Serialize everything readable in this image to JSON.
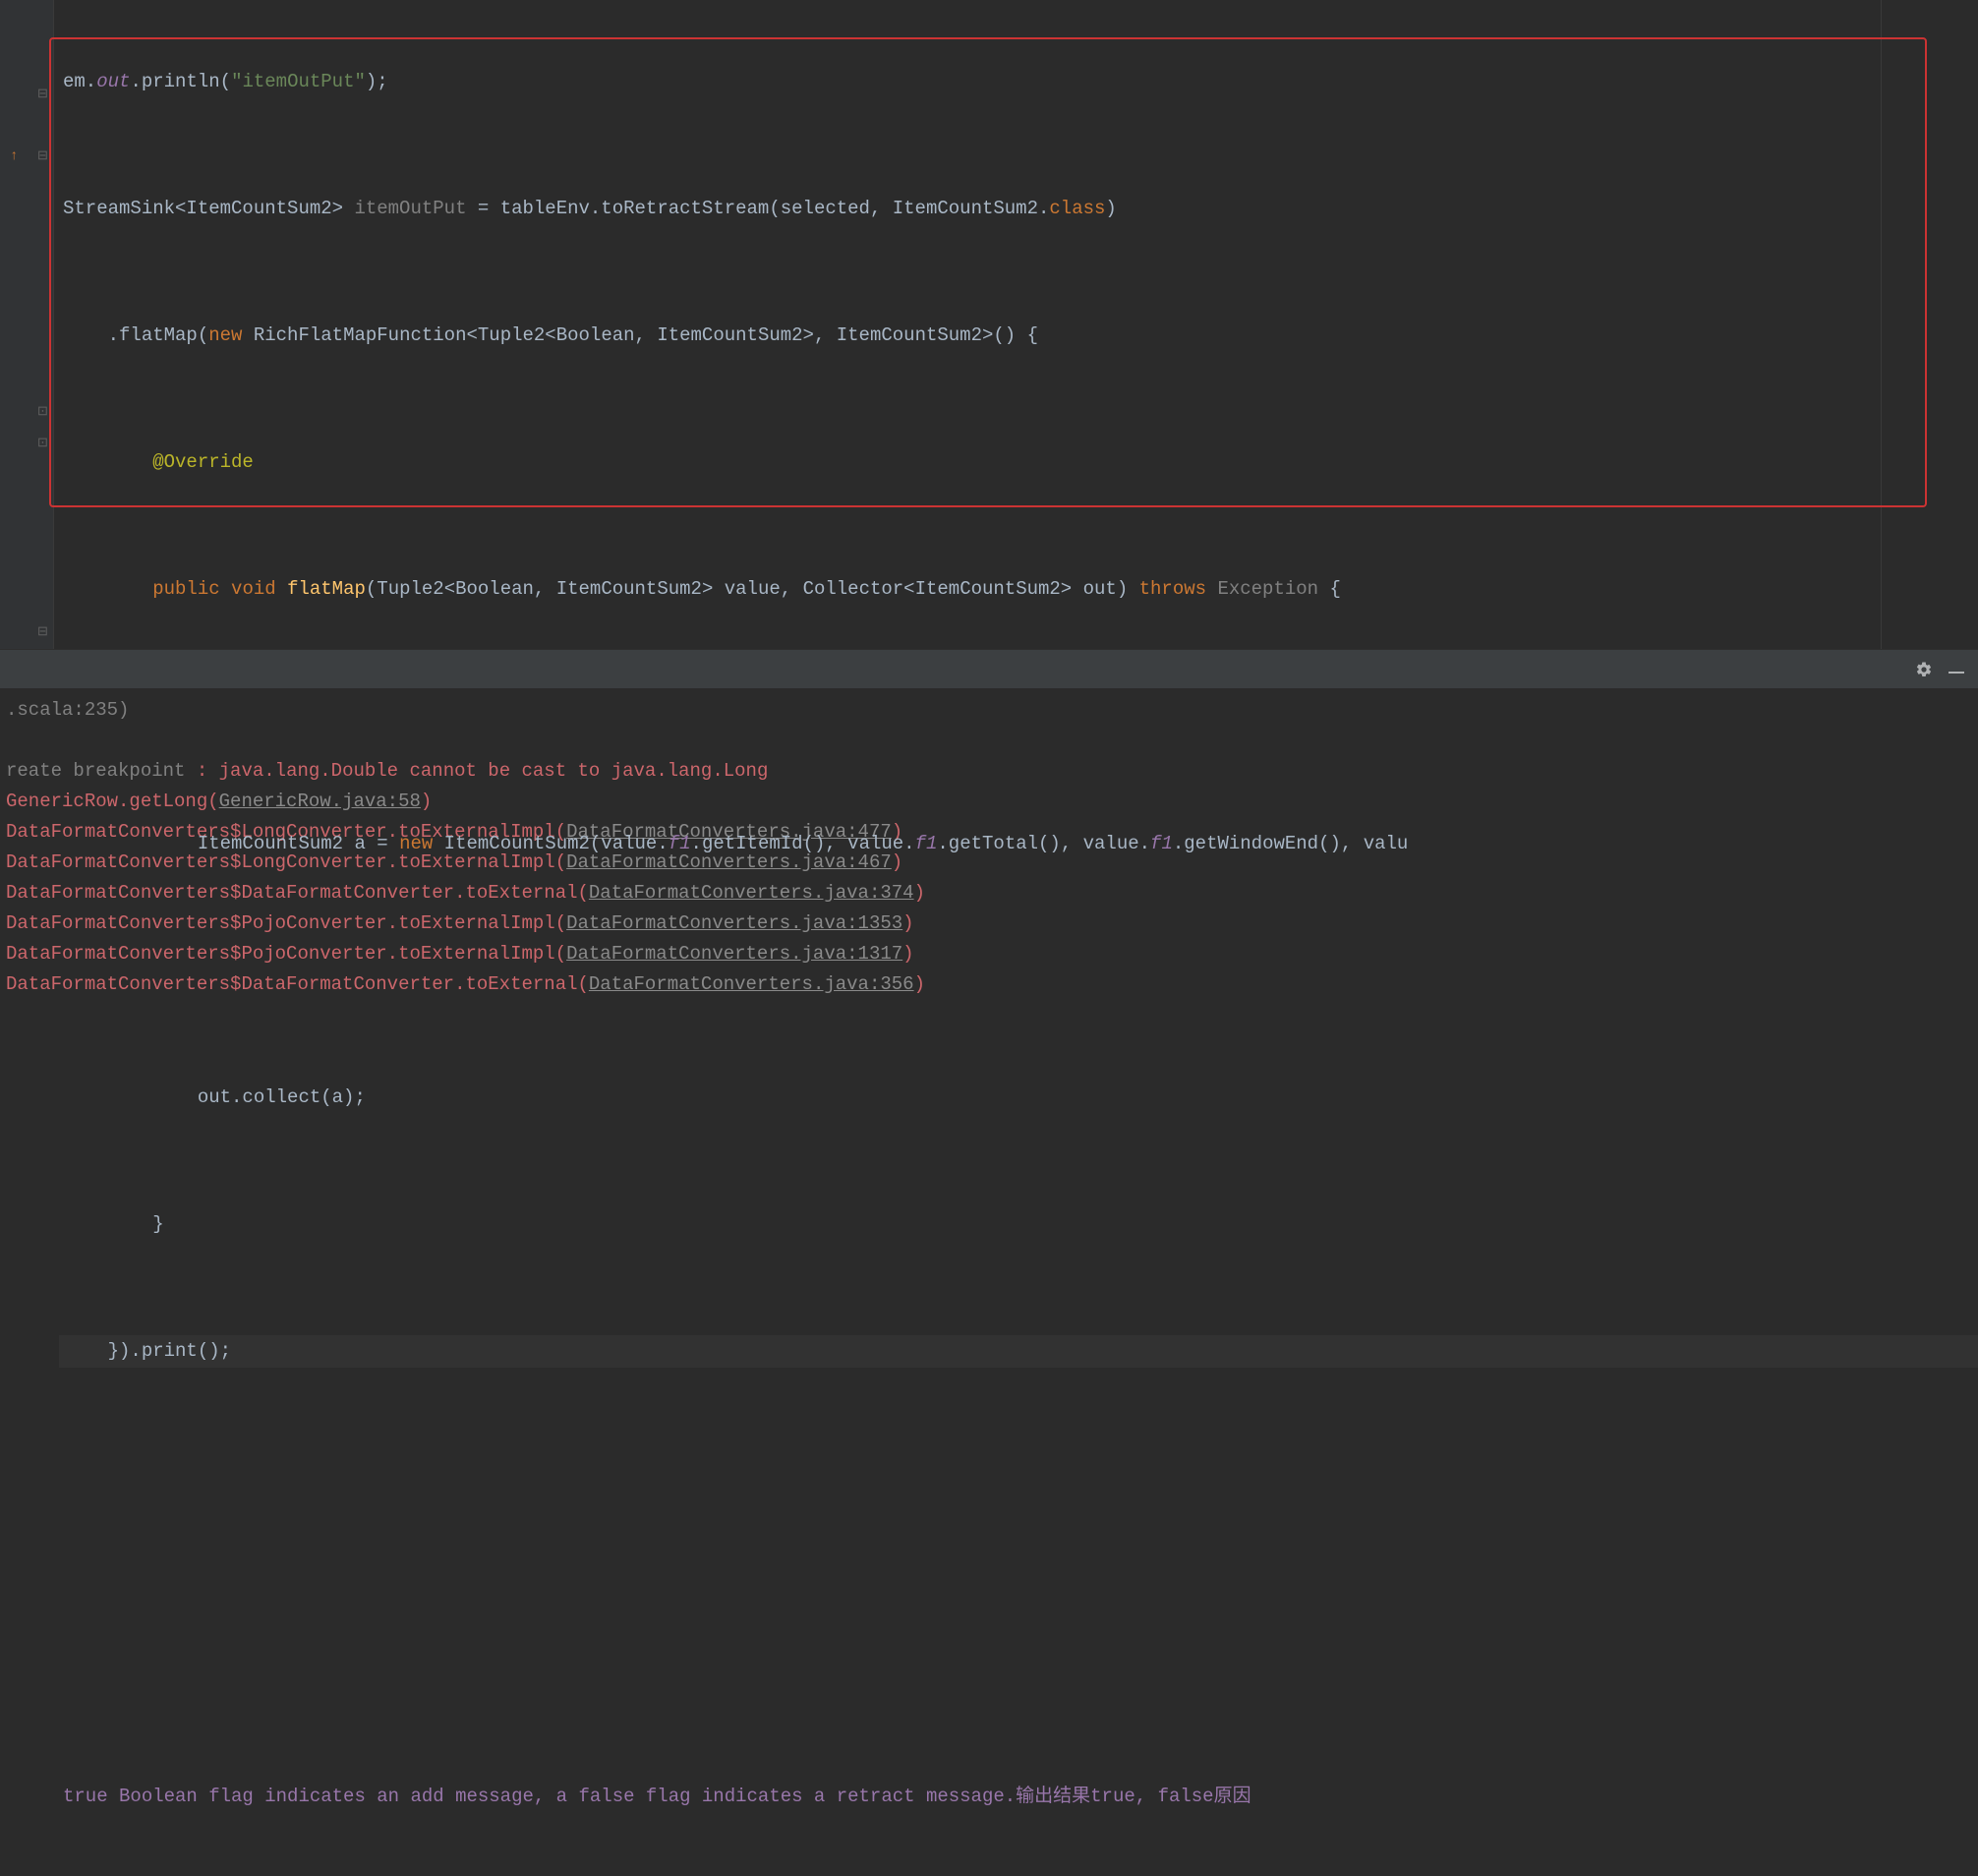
{
  "editor": {
    "lines": {
      "l1_pre": "em.",
      "l1_out": "out",
      "l1_post": ".println(",
      "l1_str": "\"itemOutPut\"",
      "l1_end": ");",
      "l2_pre": "StreamSink<ItemCountSum2> ",
      "l2_var": "itemOutPut",
      "l2_mid": " = tableEnv.toRetractStream(selected, ItemCountSum2.",
      "l2_class": "class",
      "l2_end": ")",
      "l3_pre": "    .flatMap(",
      "l3_new": "new",
      "l3_post": " RichFlatMapFunction<Tuple2<Boolean, ItemCountSum2>, ItemCountSum2>() {",
      "l4_pre": "        ",
      "l4_anno": "@Override",
      "l5_pre": "        ",
      "l5_public": "public",
      "l5_sp1": " ",
      "l5_void": "void",
      "l5_sp2": " ",
      "l5_method": "flatMap",
      "l5_post": "(Tuple2<Boolean, ItemCountSum2> value, Collector<ItemCountSum2> out) ",
      "l5_throws": "throws",
      "l5_sp3": " ",
      "l5_exc": "Exception",
      "l5_end": " {",
      "l6_pre": "            ItemCountSum2 a = ",
      "l6_new": "new",
      "l6_post": " ItemCountSum2(value.",
      "l6_f1a": "f1",
      "l6_m1": ".getItemId(), value.",
      "l6_f1b": "f1",
      "l6_m2": ".getTotal(), value.",
      "l6_f1c": "f1",
      "l6_m3": ".getWindowEnd(), valu",
      "l7": "            out.collect(a);",
      "l8": "        }",
      "l9": "    }).print();",
      "comment_pre": "true",
      "comment_rest": " Boolean flag indicates an add message, a false flag indicates a retract message.输出结果true, false原因"
    }
  },
  "console": {
    "scala_trail": ".scala:235)",
    "breakpoint_hint": "reate breakpoint",
    "exception_colon": " : ",
    "exception_msg": "java.lang.Double cannot be cast to java.lang.Long",
    "frames": [
      {
        "prefix": "GenericRow.getLong(",
        "link": "GenericRow.java:58",
        "suffix": ")"
      },
      {
        "prefix": "DataFormatConverters$LongConverter.toExternalImpl(",
        "link": "DataFormatConverters.java:477",
        "suffix": ")"
      },
      {
        "prefix": "DataFormatConverters$LongConverter.toExternalImpl(",
        "link": "DataFormatConverters.java:467",
        "suffix": ")"
      },
      {
        "prefix": "DataFormatConverters$DataFormatConverter.toExternal(",
        "link": "DataFormatConverters.java:374",
        "suffix": ")"
      },
      {
        "prefix": "DataFormatConverters$PojoConverter.toExternalImpl(",
        "link": "DataFormatConverters.java:1353",
        "suffix": ")"
      },
      {
        "prefix": "DataFormatConverters$PojoConverter.toExternalImpl(",
        "link": "DataFormatConverters.java:1317",
        "suffix": ")"
      },
      {
        "prefix": "DataFormatConverters$DataFormatConverter.toExternal(",
        "link": "DataFormatConverters.java:356",
        "suffix": ")"
      }
    ]
  }
}
